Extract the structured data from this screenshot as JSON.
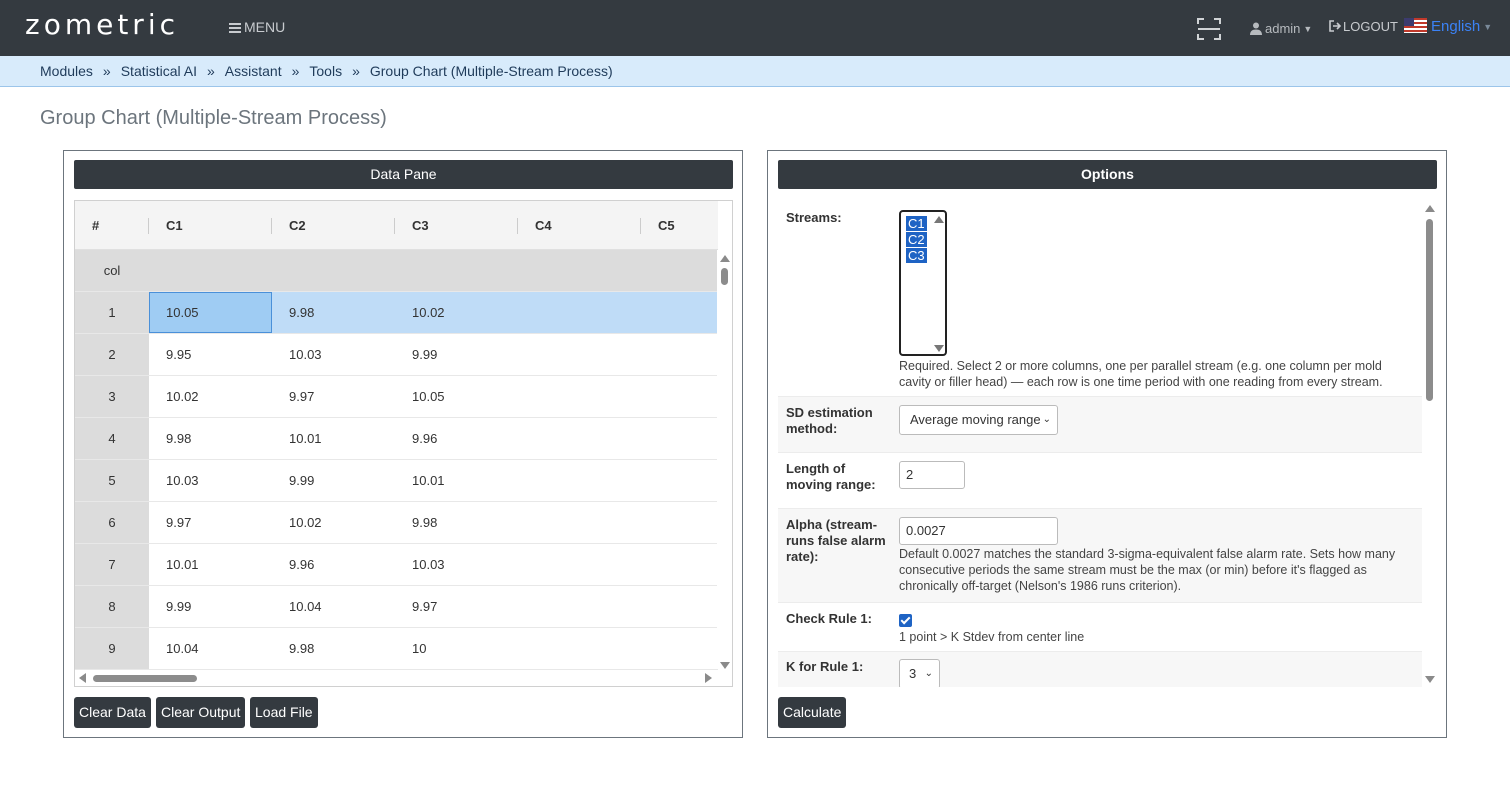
{
  "nav": {
    "logo": "zometric",
    "menu_label": "MENU",
    "user_label": "admin",
    "logout_label": "LOGOUT",
    "language_label": "English"
  },
  "breadcrumb": [
    "Modules",
    "Statistical AI",
    "Assistant",
    "Tools",
    "Group Chart (Multiple-Stream Process)"
  ],
  "page_title": "Group Chart (Multiple-Stream Process)",
  "data_pane": {
    "title": "Data Pane",
    "columns": [
      "#",
      "C1",
      "C2",
      "C3",
      "C4",
      "C5"
    ],
    "label_row": "col",
    "rows": [
      {
        "n": "1",
        "c1": "10.05",
        "c2": "9.98",
        "c3": "10.02"
      },
      {
        "n": "2",
        "c1": "9.95",
        "c2": "10.03",
        "c3": "9.99"
      },
      {
        "n": "3",
        "c1": "10.02",
        "c2": "9.97",
        "c3": "10.05"
      },
      {
        "n": "4",
        "c1": "9.98",
        "c2": "10.01",
        "c3": "9.96"
      },
      {
        "n": "5",
        "c1": "10.03",
        "c2": "9.99",
        "c3": "10.01"
      },
      {
        "n": "6",
        "c1": "9.97",
        "c2": "10.02",
        "c3": "9.98"
      },
      {
        "n": "7",
        "c1": "10.01",
        "c2": "9.96",
        "c3": "10.03"
      },
      {
        "n": "8",
        "c1": "9.99",
        "c2": "10.04",
        "c3": "9.97"
      },
      {
        "n": "9",
        "c1": "10.04",
        "c2": "9.98",
        "c3": "10"
      }
    ],
    "buttons": {
      "clear_data": "Clear Data",
      "clear_output": "Clear Output",
      "load_file": "Load File"
    }
  },
  "options": {
    "title": "Options",
    "streams": {
      "label": "Streams:",
      "selected": [
        "C1",
        "C2",
        "C3"
      ],
      "help": "Required. Select 2 or more columns, one per parallel stream (e.g. one column per mold cavity or filler head) — each row is one time period with one reading from every stream."
    },
    "sd_method": {
      "label": "SD estimation method:",
      "value": "Average moving range"
    },
    "moving_range": {
      "label": "Length of moving range:",
      "value": "2"
    },
    "alpha": {
      "label": "Alpha (stream-runs false alarm rate):",
      "value": "0.0027",
      "help": "Default 0.0027 matches the standard 3-sigma-equivalent false alarm rate. Sets how many consecutive periods the same stream must be the max (or min) before it's flagged as chronically off-target (Nelson's 1986 runs criterion)."
    },
    "rule1": {
      "label": "Check Rule 1:",
      "checked": true,
      "help": "1 point > K Stdev from center line"
    },
    "k_rule1": {
      "label": "K for Rule 1:",
      "value": "3"
    },
    "calculate_label": "Calculate"
  }
}
